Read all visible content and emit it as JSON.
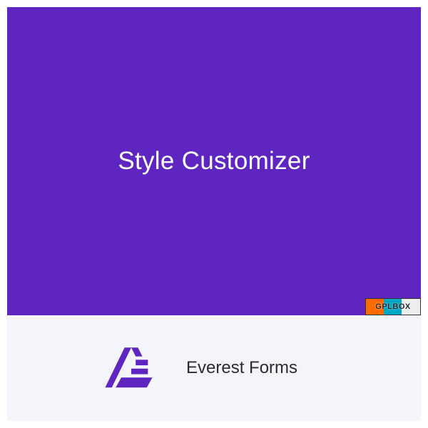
{
  "hero": {
    "title": "Style Customizer",
    "bg_color": "#5f25c0"
  },
  "watermark": {
    "label": "GPLBOX"
  },
  "footer": {
    "brand_name": "Everest Forms",
    "logo_icon_name": "everest-forms-logo",
    "bg_color": "#f3f5fa"
  }
}
